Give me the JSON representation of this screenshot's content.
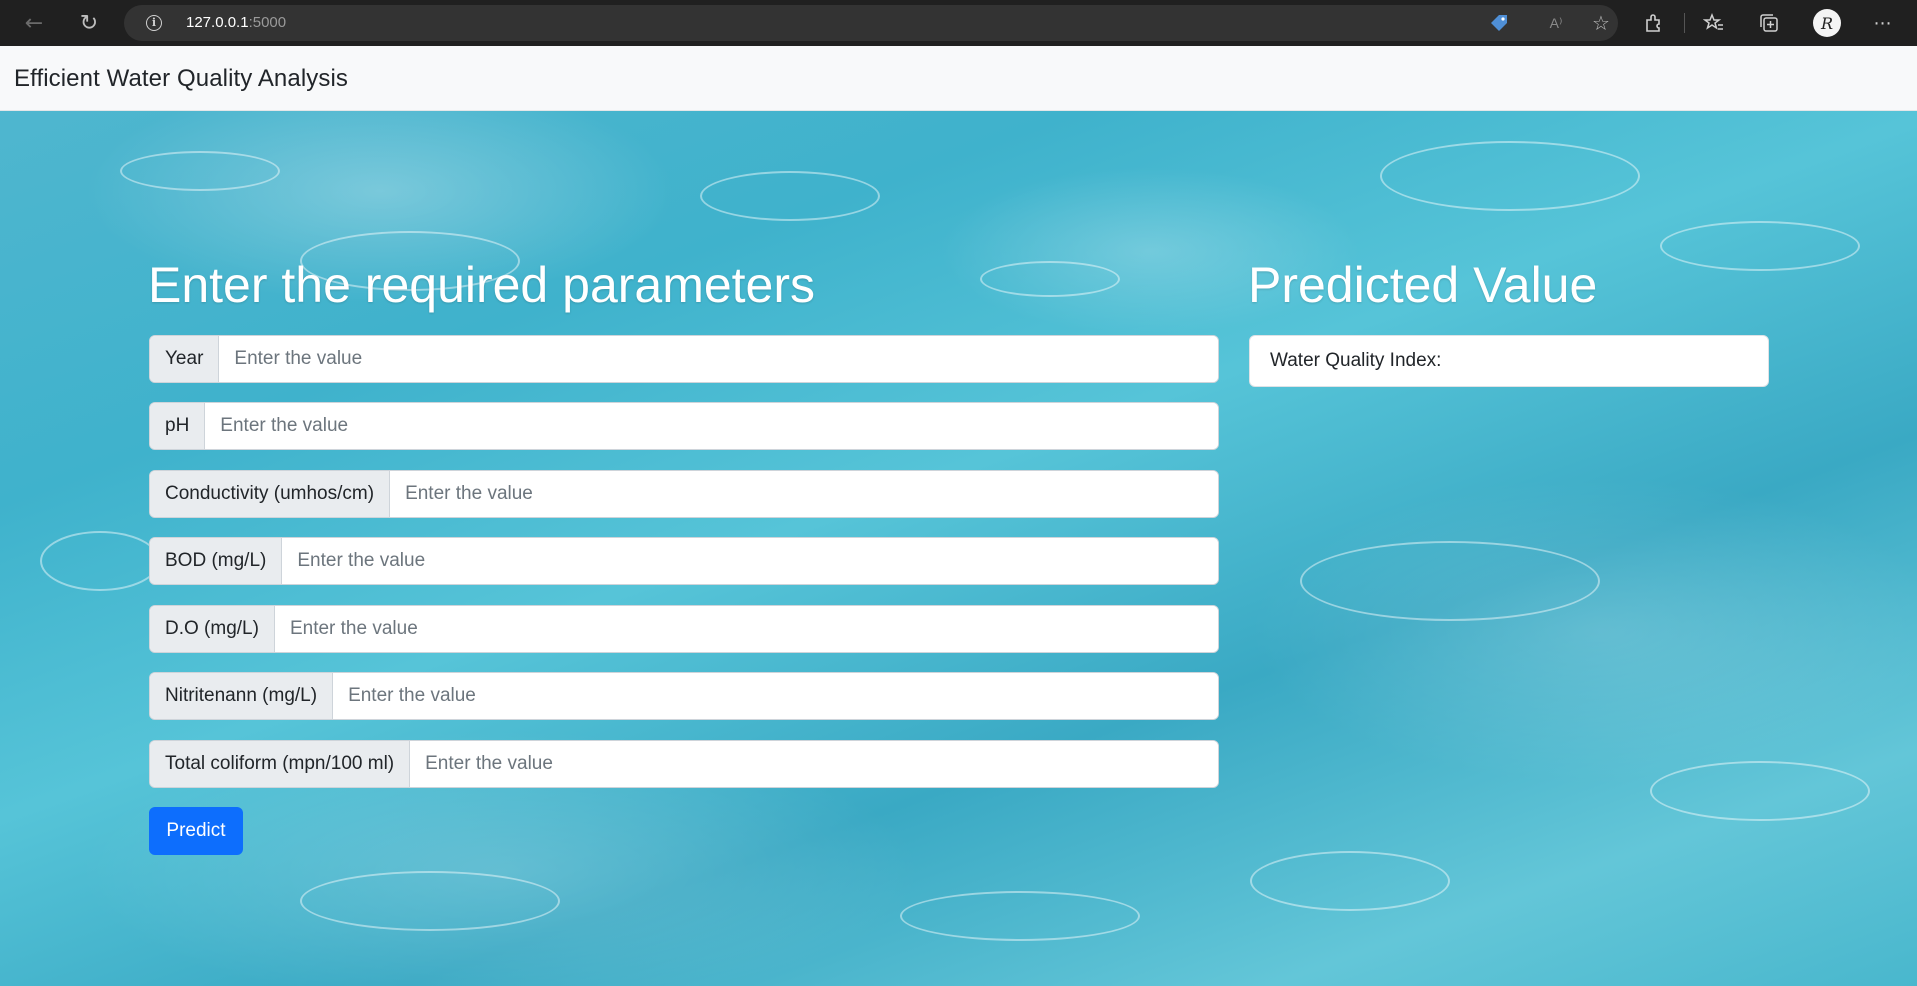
{
  "browser": {
    "url_host": "127.0.0.1",
    "url_port": ":5000",
    "icons": [
      "back-arrow-icon",
      "reload-icon",
      "info-icon",
      "tag-icon",
      "read-aloud-icon",
      "add-favorite-icon",
      "extensions-icon",
      "favorites-icon",
      "collections-icon",
      "profile-icon",
      "more-icon"
    ],
    "read_aloud_glyph": "A⁾",
    "profile_initial": "R"
  },
  "navbar": {
    "brand": "Efficient Water Quality Analysis"
  },
  "form": {
    "heading": "Enter the required parameters",
    "placeholder": "Enter the value",
    "fields": [
      {
        "label": "Year"
      },
      {
        "label": "pH"
      },
      {
        "label": "Conductivity (umhos/cm)"
      },
      {
        "label": "BOD (mg/L)"
      },
      {
        "label": "D.O (mg/L)"
      },
      {
        "label": "Nitritenann (mg/L)"
      },
      {
        "label": "Total coliform (mpn/100 ml)"
      }
    ],
    "submit_label": "Predict"
  },
  "prediction": {
    "heading": "Predicted Value",
    "result_label": "Water Quality Index:"
  },
  "colors": {
    "primary": "#0d6efd",
    "navbar_bg": "#f8f9fa",
    "water": "#3fb2cc"
  }
}
